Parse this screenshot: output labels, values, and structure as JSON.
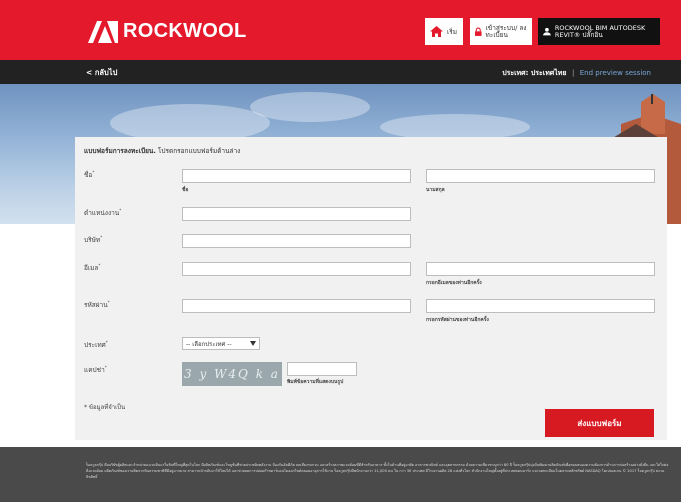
{
  "header": {
    "logo_text": "ROCKWOOL",
    "home_label": "เริ่ม",
    "login_label": "เข้าสู่ระบบ/ ลงทะเบียน",
    "bim_label": "ROCKWOOL BIM AUTODESK REVIT® ปลั๊กอิน",
    "brand_color": "#e41a2c"
  },
  "nav": {
    "back_label": "< กลับไป",
    "country_label": "ประเทศ: ประเทศไทย",
    "separator": "|",
    "end_preview": "End preview session"
  },
  "form": {
    "heading_bold": "แบบฟอร์มการลงทะเบียน.",
    "heading_rest": " โปรดกรอกแบบฟอร์มด้านล่าง",
    "fields": {
      "name_label": "ชื่อ",
      "first_name_sub": "ชื่อ",
      "last_name_sub": "นามสกุล",
      "position_label": "ตำแหน่งงาน",
      "company_label": "บริษัท",
      "email_label": "อีเมล",
      "email_confirm_sub": "กรอกอีเมลของท่านอีกครั้ง",
      "password_label": "รหัสผ่าน",
      "password_confirm_sub": "กรอกรหัสผ่านของท่านอีกครั้ง",
      "country_label": "ประเทศ",
      "country_select": "-- เลือกประเทศ --",
      "captcha_label": "แคปช่า",
      "captcha_text": "3 y W4Q k a",
      "captcha_sub": "พิมพ์ข้อความที่แสดงบนรูป",
      "required_star": "*"
    },
    "required_note": "* ข้อมูลที่จำเป็น",
    "submit_label": "ส่งแบบฟอร์ม"
  },
  "footer": {
    "text": "ร็อควูลกรุ๊ป คือบริษัทผู้ผลิตและจำหน่ายฉนวนหินแร่ใยหินที่ใหญ่ที่สุดในโลก มีผลิตภัณฑ์และโซลูชั่นที่ช่วยประหยัดพลังงาน ป้องกันอัคคีภัย ลดเสียงรบกวน และสร้างสภาพแวดล้อมที่ดีสำหรับอาคาร ทั้งในด้านที่อยู่อาศัย อาคารพาณิชย์ และอุตสาหกรรม ด้วยความเชี่ยวชาญกว่า 80 ปี ร็อควูลกรุ๊ปมุ่งมั่นพัฒนาผลิตภัณฑ์เพื่อตอบสนองความต้องการด้านการก่อสร้างอย่างยั่งยืน และใส่ใจต่อสิ่งแวดล้อม ผลิตภัณฑ์ของเราผลิตจากหินธรรมชาติที่มีอยู่มากมาย สามารถนำกลับมาใช้ใหม่ได้ และช่วยลดการปล่อยก๊าซคาร์บอนไดออกไซด์ตลอดอายุการใช้งาน ร็อควูลกรุ๊ปมีพนักงานกว่า 11,000 คน ใน กว่า 30 ประเทศ มีโรงงานผลิต 28 แห่งทั่วโลก สำนักงานใหญ่ตั้งอยู่ที่ประเทศเดนมาร์ก และจดทะเบียนในตลาดหลักทรัพย์ NASDAQ โคเปนเฮเกน © 2017 ร็อควูลกรุ๊ป สงวนลิขสิทธิ์"
  }
}
